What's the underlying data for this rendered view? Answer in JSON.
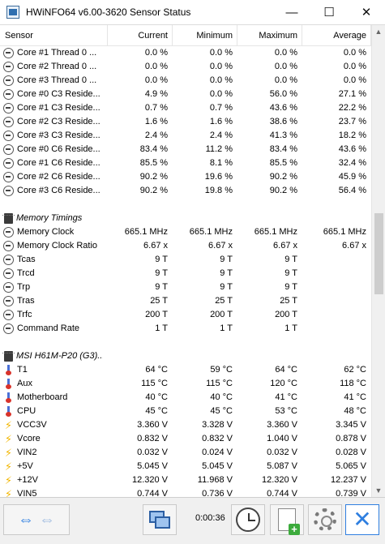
{
  "window": {
    "title": "HWiNFO64 v6.00-3620 Sensor Status",
    "minimize_glyph": "—",
    "maximize_glyph": "☐",
    "close_glyph": "✕"
  },
  "columns": [
    "Sensor",
    "Current",
    "Minimum",
    "Maximum",
    "Average"
  ],
  "rows": [
    {
      "icon": "clock-icon",
      "name": "Core #1 Thread 0 ...",
      "current": "0.0 %",
      "minimum": "0.0 %",
      "maximum": "0.0 %",
      "average": "0.0 %"
    },
    {
      "icon": "clock-icon",
      "name": "Core #2 Thread 0 ...",
      "current": "0.0 %",
      "minimum": "0.0 %",
      "maximum": "0.0 %",
      "average": "0.0 %"
    },
    {
      "icon": "clock-icon",
      "name": "Core #3 Thread 0 ...",
      "current": "0.0 %",
      "minimum": "0.0 %",
      "maximum": "0.0 %",
      "average": "0.0 %"
    },
    {
      "icon": "clock-icon",
      "name": "Core #0 C3 Reside...",
      "current": "4.9 %",
      "minimum": "0.0 %",
      "maximum": "56.0 %",
      "average": "27.1 %"
    },
    {
      "icon": "clock-icon",
      "name": "Core #1 C3 Reside...",
      "current": "0.7 %",
      "minimum": "0.7 %",
      "maximum": "43.6 %",
      "average": "22.2 %"
    },
    {
      "icon": "clock-icon",
      "name": "Core #2 C3 Reside...",
      "current": "1.6 %",
      "minimum": "1.6 %",
      "maximum": "38.6 %",
      "average": "23.7 %"
    },
    {
      "icon": "clock-icon",
      "name": "Core #3 C3 Reside...",
      "current": "2.4 %",
      "minimum": "2.4 %",
      "maximum": "41.3 %",
      "average": "18.2 %"
    },
    {
      "icon": "clock-icon",
      "name": "Core #0 C6 Reside...",
      "current": "83.4 %",
      "minimum": "11.2 %",
      "maximum": "83.4 %",
      "average": "43.6 %"
    },
    {
      "icon": "clock-icon",
      "name": "Core #1 C6 Reside...",
      "current": "85.5 %",
      "minimum": "8.1 %",
      "maximum": "85.5 %",
      "average": "32.4 %"
    },
    {
      "icon": "clock-icon",
      "name": "Core #2 C6 Reside...",
      "current": "90.2 %",
      "minimum": "19.6 %",
      "maximum": "90.2 %",
      "average": "45.9 %"
    },
    {
      "icon": "clock-icon",
      "name": "Core #3 C6 Reside...",
      "current": "90.2 %",
      "minimum": "19.8 %",
      "maximum": "90.2 %",
      "average": "56.4 %"
    },
    {
      "spacer": true
    },
    {
      "group": true,
      "icon": "chip-icon",
      "name": "Memory Timings"
    },
    {
      "icon": "clock-icon",
      "name": "Memory Clock",
      "current": "665.1 MHz",
      "minimum": "665.1 MHz",
      "maximum": "665.1 MHz",
      "average": "665.1 MHz"
    },
    {
      "icon": "clock-icon",
      "name": "Memory Clock Ratio",
      "current": "6.67 x",
      "minimum": "6.67 x",
      "maximum": "6.67 x",
      "average": "6.67 x"
    },
    {
      "icon": "clock-icon",
      "name": "Tcas",
      "current": "9 T",
      "minimum": "9 T",
      "maximum": "9 T",
      "average": ""
    },
    {
      "icon": "clock-icon",
      "name": "Trcd",
      "current": "9 T",
      "minimum": "9 T",
      "maximum": "9 T",
      "average": ""
    },
    {
      "icon": "clock-icon",
      "name": "Trp",
      "current": "9 T",
      "minimum": "9 T",
      "maximum": "9 T",
      "average": ""
    },
    {
      "icon": "clock-icon",
      "name": "Tras",
      "current": "25 T",
      "minimum": "25 T",
      "maximum": "25 T",
      "average": ""
    },
    {
      "icon": "clock-icon",
      "name": "Trfc",
      "current": "200 T",
      "minimum": "200 T",
      "maximum": "200 T",
      "average": ""
    },
    {
      "icon": "clock-icon",
      "name": "Command Rate",
      "current": "1 T",
      "minimum": "1 T",
      "maximum": "1 T",
      "average": ""
    },
    {
      "spacer": true
    },
    {
      "group": true,
      "icon": "chip-icon",
      "name": "MSI H61M-P20 (G3)..."
    },
    {
      "icon": "thermometer-icon",
      "name": "T1",
      "current": "64 °C",
      "minimum": "59 °C",
      "maximum": "64 °C",
      "average": "62 °C"
    },
    {
      "icon": "thermometer-icon",
      "name": "Aux",
      "current": "115 °C",
      "minimum": "115 °C",
      "maximum": "120 °C",
      "average": "118 °C"
    },
    {
      "icon": "thermometer-icon",
      "name": "Motherboard",
      "current": "40 °C",
      "minimum": "40 °C",
      "maximum": "41 °C",
      "average": "41 °C"
    },
    {
      "icon": "thermometer-icon",
      "name": "CPU",
      "current": "45 °C",
      "minimum": "45 °C",
      "maximum": "53 °C",
      "average": "48 °C"
    },
    {
      "icon": "lightning-icon",
      "name": "VCC3V",
      "current": "3.360 V",
      "minimum": "3.328 V",
      "maximum": "3.360 V",
      "average": "3.345 V"
    },
    {
      "icon": "lightning-icon",
      "name": "Vcore",
      "current": "0.832 V",
      "minimum": "0.832 V",
      "maximum": "1.040 V",
      "average": "0.878 V"
    },
    {
      "icon": "lightning-icon",
      "name": "VIN2",
      "current": "0.032 V",
      "minimum": "0.024 V",
      "maximum": "0.032 V",
      "average": "0.028 V"
    },
    {
      "icon": "lightning-icon",
      "name": "+5V",
      "current": "5.045 V",
      "minimum": "5.045 V",
      "maximum": "5.087 V",
      "average": "5.065 V"
    },
    {
      "icon": "lightning-icon",
      "name": "+12V",
      "current": "12.320 V",
      "minimum": "11.968 V",
      "maximum": "12.320 V",
      "average": "12.237 V"
    },
    {
      "icon": "lightning-icon",
      "name": "VIN5",
      "current": "0.744 V",
      "minimum": "0.736 V",
      "maximum": "0.744 V",
      "average": "0.739 V"
    }
  ],
  "toolbar": {
    "timer": "0:00:36",
    "nav_left_glyph": "⇔",
    "nav_right_glyph": "⇔"
  }
}
